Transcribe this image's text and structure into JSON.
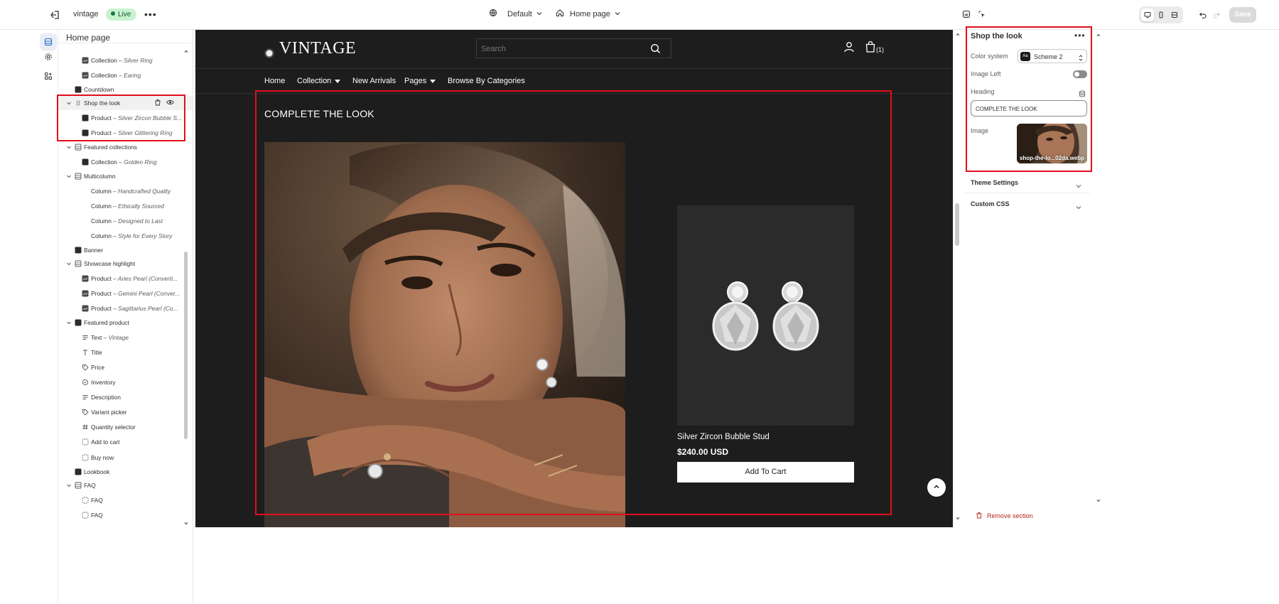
{
  "topbar": {
    "store_name": "vintage",
    "status_badge": "Live",
    "more": "•••",
    "theme": "Default",
    "template": "Home page",
    "save_label": "Save"
  },
  "left_panel": {
    "title": "Home page",
    "items": [
      {
        "label": "Collection",
        "detail": "Silver Ring"
      },
      {
        "label": "Collection",
        "detail": "Earing"
      },
      {
        "label": "Countdown",
        "detail": ""
      },
      {
        "label": "Shop the look",
        "detail": ""
      },
      {
        "label": "Product",
        "detail": "Silver Zircon Bubble S..."
      },
      {
        "label": "Product",
        "detail": "Silver Glittering Ring"
      },
      {
        "label": "Featured collections",
        "detail": ""
      },
      {
        "label": "Collection",
        "detail": "Golden Ring"
      },
      {
        "label": "Multicolumn",
        "detail": ""
      },
      {
        "label": "Column",
        "detail": "Handcrafted Quality"
      },
      {
        "label": "Column",
        "detail": "Ethically Sourced"
      },
      {
        "label": "Column",
        "detail": "Designed to Last"
      },
      {
        "label": "Column",
        "detail": "Style for Every Story"
      },
      {
        "label": "Banner",
        "detail": ""
      },
      {
        "label": "Showcase highlight",
        "detail": ""
      },
      {
        "label": "Product",
        "detail": "Aries Pearl (Converti..."
      },
      {
        "label": "Product",
        "detail": "Gemini Pearl (Conver..."
      },
      {
        "label": "Product",
        "detail": "Sagittarius Pearl (Co..."
      },
      {
        "label": "Featured product",
        "detail": ""
      },
      {
        "label": "Text",
        "detail": "Vintage"
      },
      {
        "label": "Title",
        "detail": ""
      },
      {
        "label": "Price",
        "detail": ""
      },
      {
        "label": "Inventory",
        "detail": ""
      },
      {
        "label": "Description",
        "detail": ""
      },
      {
        "label": "Variant picker",
        "detail": ""
      },
      {
        "label": "Quantity selector",
        "detail": ""
      },
      {
        "label": "Add to cart",
        "detail": ""
      },
      {
        "label": "Buy now",
        "detail": ""
      },
      {
        "label": "Lookbook",
        "detail": ""
      },
      {
        "label": "FAQ",
        "detail": ""
      },
      {
        "label": "FAQ",
        "detail": ""
      },
      {
        "label": "FAQ",
        "detail": ""
      }
    ],
    "separator": " – "
  },
  "preview": {
    "logo": "VINTAGE",
    "search_placeholder": "Search",
    "cart_count": "(1)",
    "nav": [
      "Home",
      "Collection",
      "New Arrivals",
      "Pages",
      "Browse By Categories"
    ],
    "section_title": "COMPLETE THE LOOK",
    "product_name": "Silver Zircon Bubble Stud",
    "product_price": "$240.00 USD",
    "add_to_cart": "Add To Cart"
  },
  "settings": {
    "title": "Shop the look",
    "color_system_label": "Color system",
    "color_system_swatch": "Aa",
    "color_system_value": "Scheme 2",
    "image_left_label": "Image Left",
    "image_left_on": false,
    "heading_label": "Heading",
    "heading_value": "COMPLETE THE LOOK",
    "image_label": "Image",
    "image_filename": "shop-the-lo...02da.webp",
    "theme_settings": "Theme Settings",
    "custom_css": "Custom CSS",
    "remove_section": "Remove section"
  },
  "colors": {
    "highlight": "#e10f1b",
    "store_bg": "#1d1d1d",
    "live_badge": "#c9f2cf",
    "danger": "#b3261e"
  }
}
